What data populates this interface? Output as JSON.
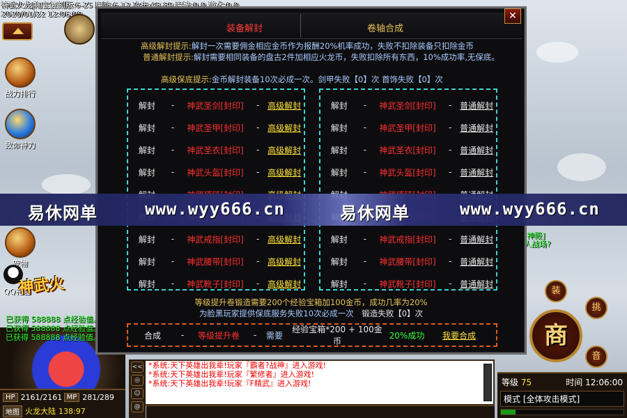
{
  "hud": {
    "stats_line": "神武火龙|淘宝复刻版:6-25 魔防:6-12 攻击:48-89 魔法:0-0 道术:0-0",
    "datetime": "2020/01/22 12:06:00",
    "left_buttons": [
      "战力排行",
      "致命神力",
      "宠物"
    ],
    "qq_label": "QQ礼包",
    "banner_text": "神武火",
    "gain_lines": [
      "已获得 588888 点经验值。",
      "已获得 588888 点经验值。",
      "已获得 588888 点经验值。"
    ],
    "hp_label": "HP",
    "hp": "2161/2161",
    "mp_label": "MP",
    "mp": "281/289",
    "map_label": "地图",
    "map_name": "火龙大陆",
    "coords": "138:97",
    "chat_lines": [
      "*系统:天下英雄出我辈!玩家『霸者?战神』进入游戏!",
      "*系统:天下英雄出我辈!玩家『繁修者』进入游戏!",
      "*系统:天下英雄出我辈!玩家『F精武』进入游戏!"
    ],
    "chat_icons": [
      "<<",
      "◎",
      "☺",
      "@"
    ],
    "shop_label": "商",
    "round_buttons": [
      "装",
      "挑",
      "音"
    ],
    "level_label": "等级",
    "level": "75",
    "time_label": "时间",
    "time": "12:06:00",
    "mode_label": "模式",
    "mode": "[全体攻击模式]",
    "exp_fraction": 0.12,
    "right_note": [
      "[神殿]",
      "人战场?"
    ]
  },
  "dialog": {
    "tabs": [
      "装备解封",
      "卷轴合成"
    ],
    "close": "✕",
    "hint1_label": "高级解封提示:",
    "hint1_text": "解封一次需要佣金相应金币作为报酬20%机率成功，失败不扣除装备只扣除金币",
    "hint2_label": "普通解封提示:",
    "hint2_text": "解封需要相同装备的盘古2件加相应火龙币，失败扣除所有东西，10%成功率,无保底。",
    "guarantee_label": "高级保底提示:",
    "guarantee_text": "金币解封装备10次必成一次。剑甲失败【0】次 首饰失败【0】次",
    "row_action": "解封",
    "row_dash": "-",
    "left_button": "高级解封",
    "right_button": "普通解封",
    "items": [
      "神武圣剑[封印]",
      "神武圣甲[封印]",
      "神武圣衣[封印]",
      "神武头盔[封印]",
      "神武项链[封印]",
      "神武手镯[封印]",
      "神武戒指[封印]",
      "神武腰带[封印]",
      "神武靴子[封印]"
    ],
    "upgrade_line1": "等级提升卷锻造需要200个经验宝箱加100金币，成功几率为20%",
    "upgrade_line2": "为脸黑玩家提供保底服务失败10次必成一次",
    "upgrade_fail": "锻造失败【0】次",
    "craft": {
      "label": "合成",
      "dash": "-",
      "item": "等级提升卷",
      "need": "需要",
      "cost": "经验宝箱*200 + 100金币",
      "rate": "20%成功",
      "button": "我要合成"
    }
  },
  "watermark": [
    "易休网单",
    "www.wyy666.cn",
    "易休网单",
    "www.wyy666.cn"
  ]
}
